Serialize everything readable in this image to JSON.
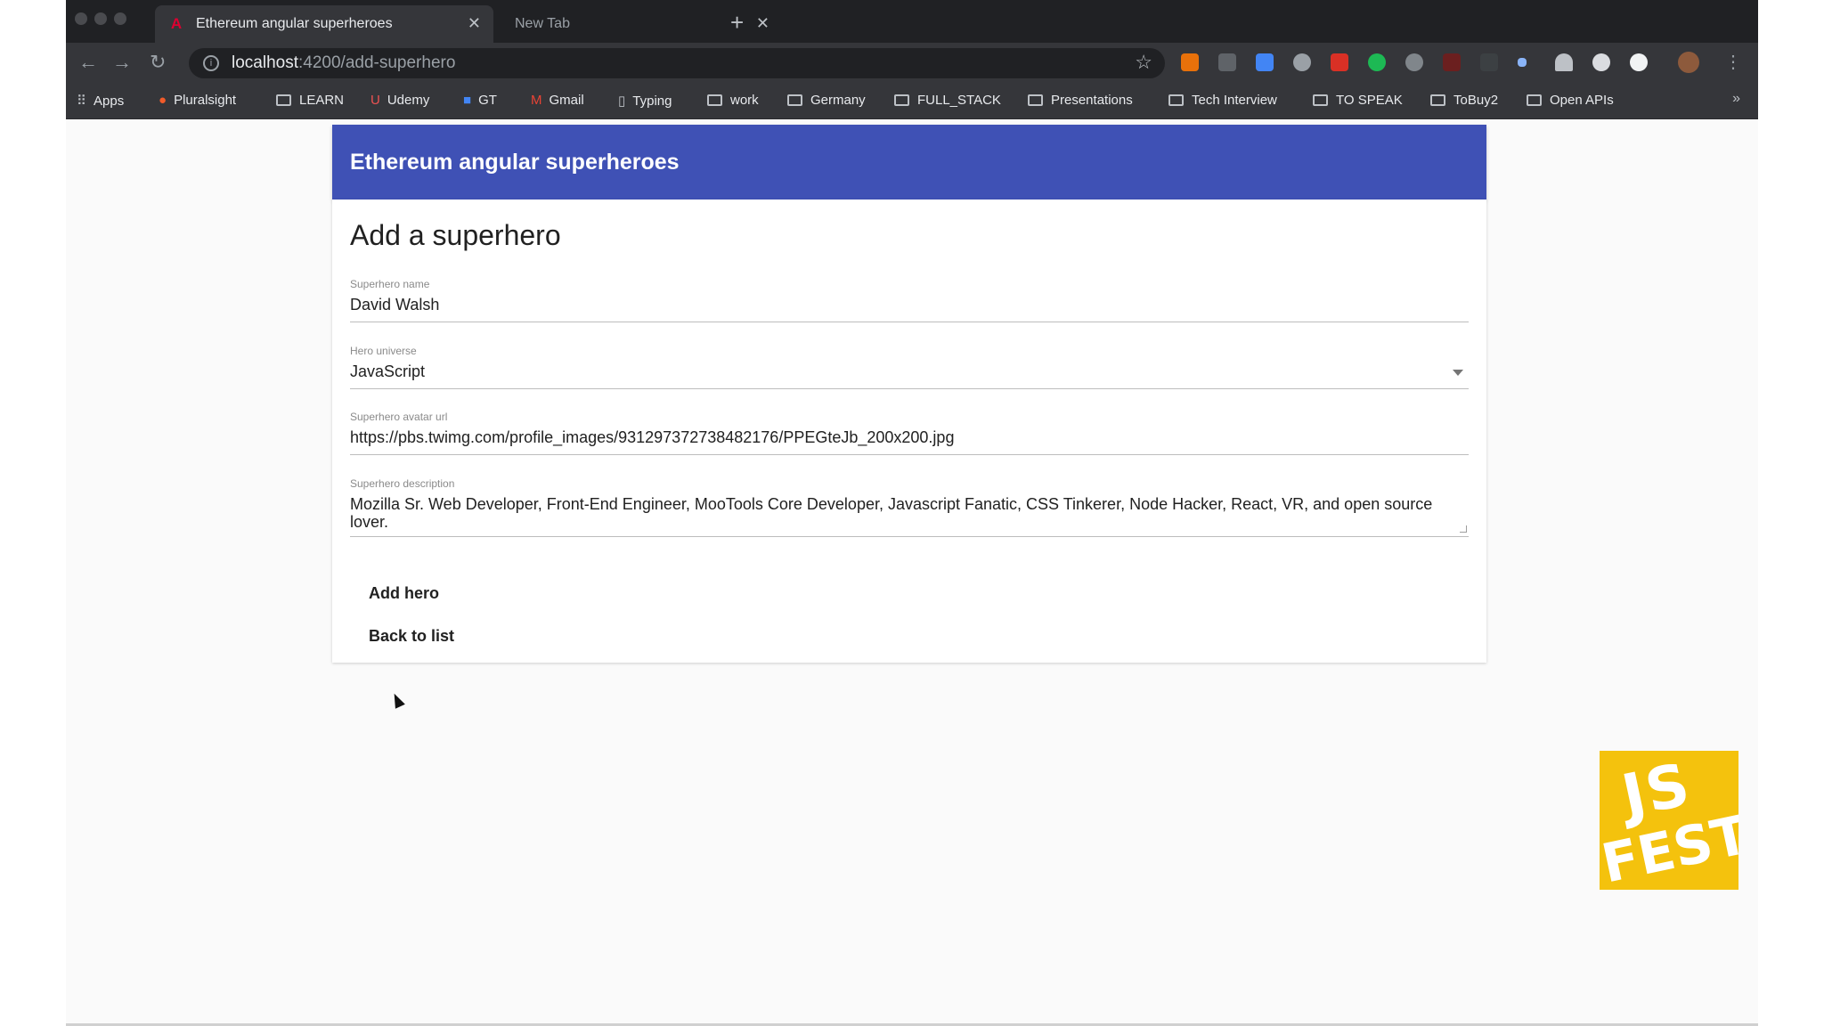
{
  "browser": {
    "tabs": [
      {
        "title": "Ethereum angular superheroes",
        "favicon": "angular-icon",
        "active": true
      },
      {
        "title": "New Tab",
        "active": false
      }
    ],
    "address": {
      "host": "localhost",
      "path": ":4200/add-superhero"
    },
    "bookmarks": [
      {
        "label": "Apps",
        "icon": "apps-grid-icon"
      },
      {
        "label": "Pluralsight",
        "icon": "pluralsight-icon"
      },
      {
        "label": "LEARN",
        "icon": "folder-icon"
      },
      {
        "label": "Udemy",
        "icon": "udemy-icon"
      },
      {
        "label": "GT",
        "icon": "translate-icon"
      },
      {
        "label": "Gmail",
        "icon": "gmail-icon"
      },
      {
        "label": "Typing",
        "icon": "page-icon"
      },
      {
        "label": "work",
        "icon": "folder-icon"
      },
      {
        "label": "Germany",
        "icon": "folder-icon"
      },
      {
        "label": "FULL_STACK",
        "icon": "folder-icon"
      },
      {
        "label": "Presentations",
        "icon": "folder-icon"
      },
      {
        "label": "Tech Interview",
        "icon": "folder-icon"
      },
      {
        "label": "TO SPEAK",
        "icon": "folder-icon"
      },
      {
        "label": "ToBuy2",
        "icon": "folder-icon"
      },
      {
        "label": "Open APIs",
        "icon": "folder-icon"
      }
    ],
    "more_label": "»"
  },
  "app": {
    "title": "Ethereum angular superheroes"
  },
  "form": {
    "title": "Add a superhero",
    "name": {
      "label": "Superhero name",
      "value": "David Walsh"
    },
    "universe": {
      "label": "Hero universe",
      "value": "JavaScript"
    },
    "avatar": {
      "label": "Superhero avatar url",
      "value": "https://pbs.twimg.com/profile_images/931297372738482176/PPEGteJb_200x200.jpg"
    },
    "description": {
      "label": "Superhero description",
      "value": "Mozilla Sr. Web Developer, Front-End Engineer, MooTools Core Developer, Javascript Fanatic, CSS Tinkerer, Node Hacker, React, VR, and open source lover."
    },
    "add_button": "Add hero",
    "back_button": "Back to list"
  },
  "logo": {
    "line1": "JS",
    "line2": "FEST",
    "color": "#f4c20d"
  },
  "colors": {
    "app_bar": "#3f51b5",
    "chrome_dark": "#202124",
    "chrome_toolbar": "#35363a"
  }
}
